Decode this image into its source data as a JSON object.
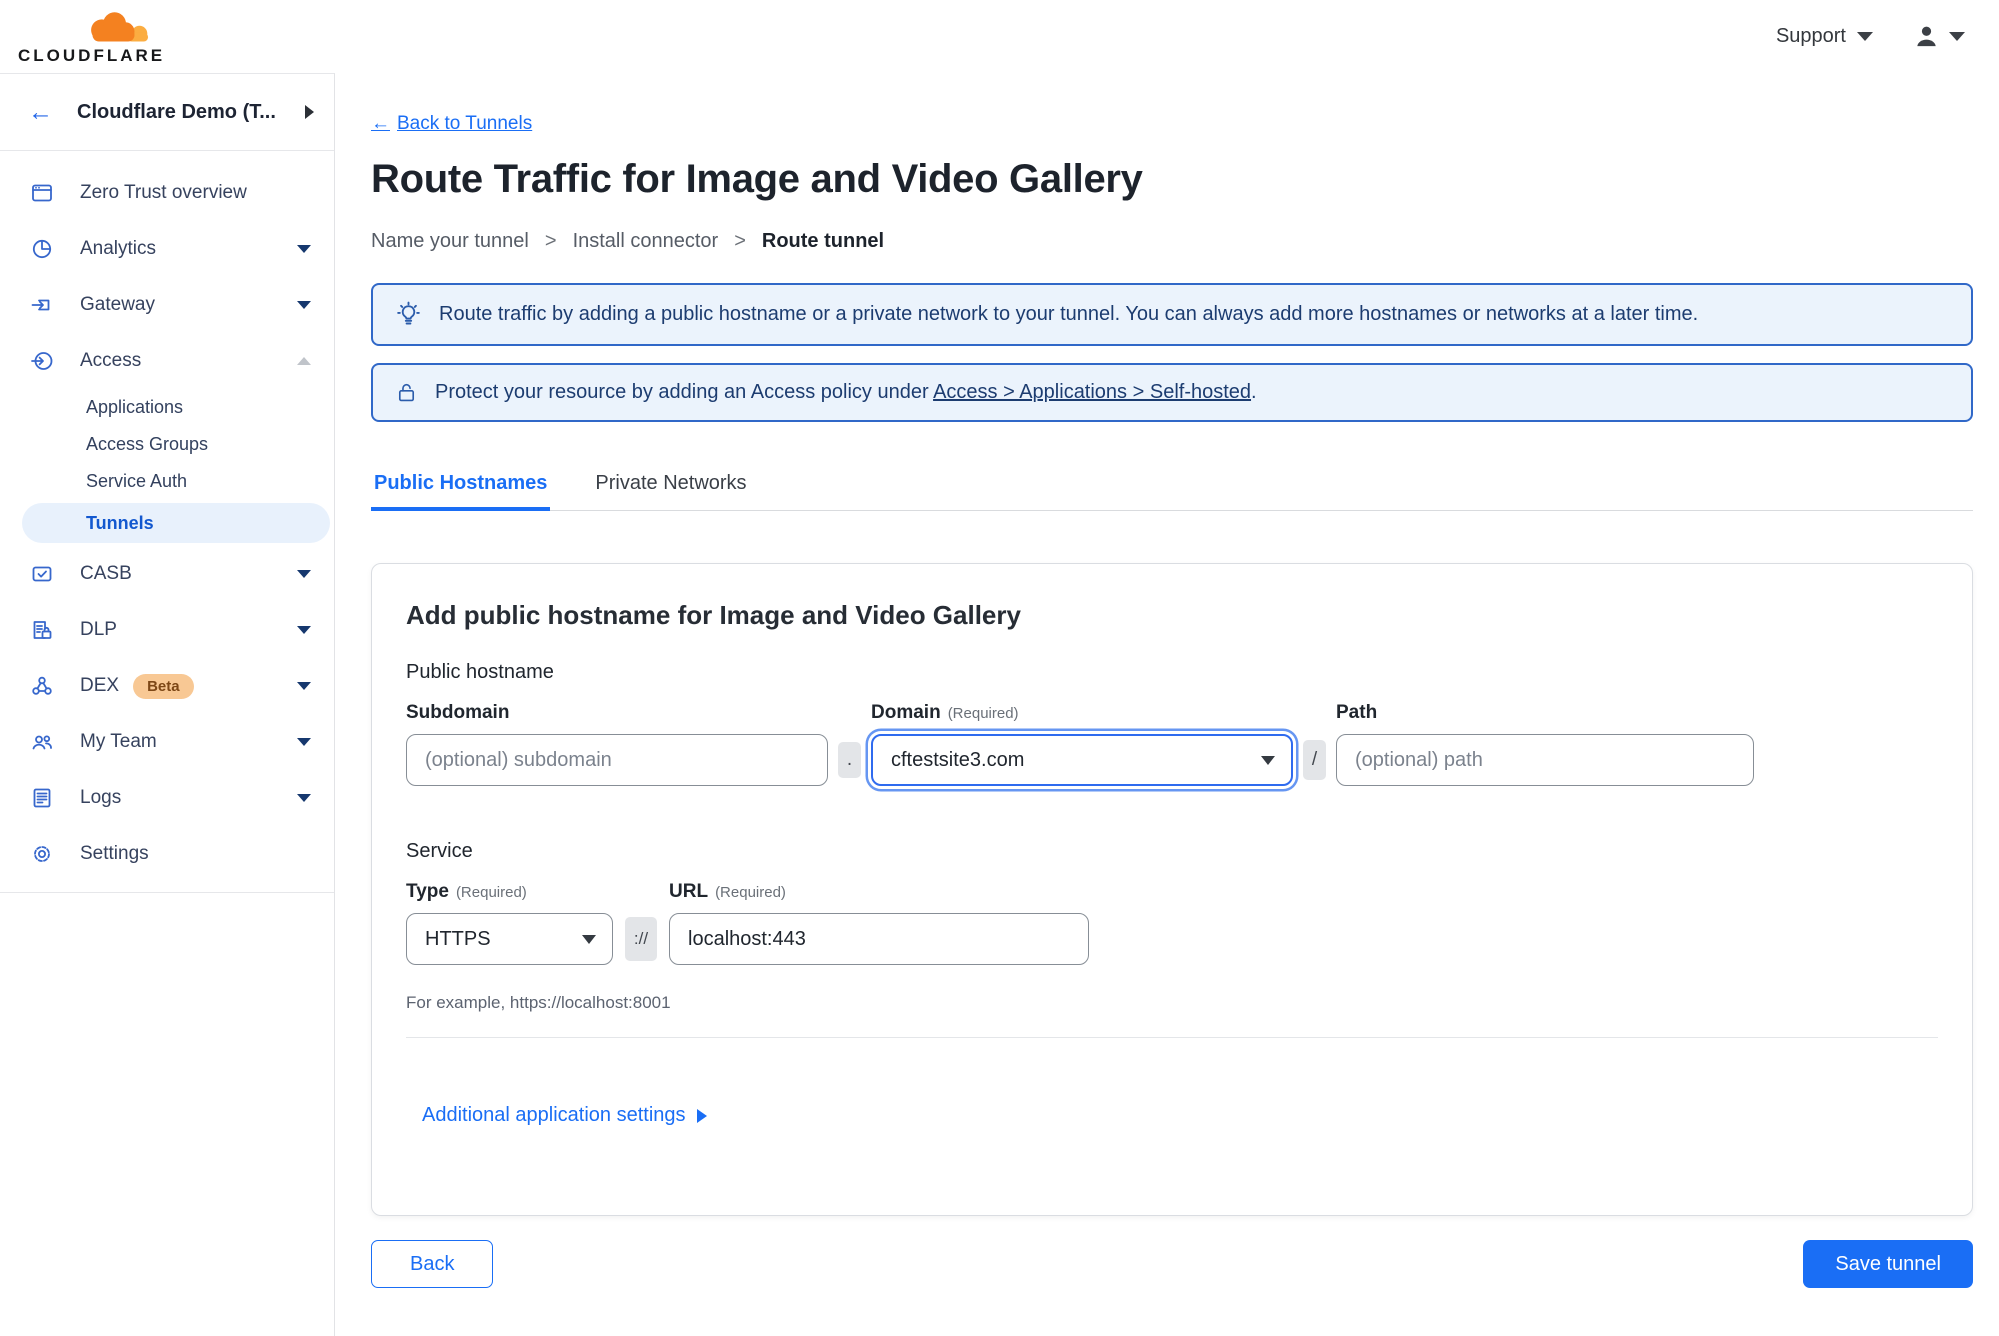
{
  "topbar": {
    "brand": "CLOUDFLARE",
    "support_label": "Support"
  },
  "icons": {
    "back_arrow": "←"
  },
  "sidebar": {
    "account_name": "Cloudflare Demo (T...",
    "items": [
      {
        "label": "Zero Trust overview"
      },
      {
        "label": "Analytics"
      },
      {
        "label": "Gateway"
      },
      {
        "label": "Access"
      },
      {
        "label": "Applications"
      },
      {
        "label": "Access Groups"
      },
      {
        "label": "Service Auth"
      },
      {
        "label": "Tunnels"
      },
      {
        "label": "CASB"
      },
      {
        "label": "DLP"
      },
      {
        "label": "DEX",
        "badge": "Beta"
      },
      {
        "label": "My Team"
      },
      {
        "label": "Logs"
      },
      {
        "label": "Settings"
      }
    ]
  },
  "main": {
    "back_label": "Back to Tunnels",
    "title": "Route Traffic for Image and Video Gallery",
    "steps": [
      "Name your tunnel",
      "Install connector",
      "Route tunnel"
    ],
    "step_separator": ">",
    "banners": [
      {
        "icon": "lightbulb-icon",
        "text": "Route traffic by adding a public hostname or a private network to your tunnel. You can always add more hostnames or networks at a later time."
      },
      {
        "icon": "lock-icon",
        "text_before": "Protect your resource by adding an Access policy under ",
        "link": "Access > Applications > Self-hosted",
        "text_after": "."
      }
    ],
    "tabs": [
      {
        "label": "Public Hostnames",
        "active": true
      },
      {
        "label": "Private Networks",
        "active": false
      }
    ]
  },
  "card": {
    "heading": "Add public hostname for Image and Video Gallery",
    "public_hostname_label": "Public hostname",
    "subdomain": {
      "label": "Subdomain",
      "placeholder": "(optional) subdomain"
    },
    "domain": {
      "label": "Domain",
      "required": "(Required)",
      "value": "cftestsite3.com"
    },
    "path": {
      "label": "Path",
      "placeholder": "(optional) path"
    },
    "separators": {
      "dot": ".",
      "slash": "/",
      "scheme": "://"
    },
    "service_label": "Service",
    "type": {
      "label": "Type",
      "required": "(Required)",
      "value": "HTTPS"
    },
    "url": {
      "label": "URL",
      "required": "(Required)",
      "value": "localhost:443"
    },
    "example": "For example, https://localhost:8001",
    "additional_settings_label": "Additional application settings"
  },
  "footer": {
    "back_label": "Back",
    "save_label": "Save tunnel"
  },
  "colors": {
    "accent": "#1a6ef5",
    "banner_bg": "#ebf3fc",
    "banner_border": "#3068c8",
    "banner_text": "#1c3c70",
    "selected_bg": "#e8f1fc",
    "selected_text": "#1358cf",
    "badge_bg": "#f8c894",
    "badge_text": "#7d4716",
    "url_bg": "#e7effc",
    "sidebar_icon": "#3767cc"
  }
}
